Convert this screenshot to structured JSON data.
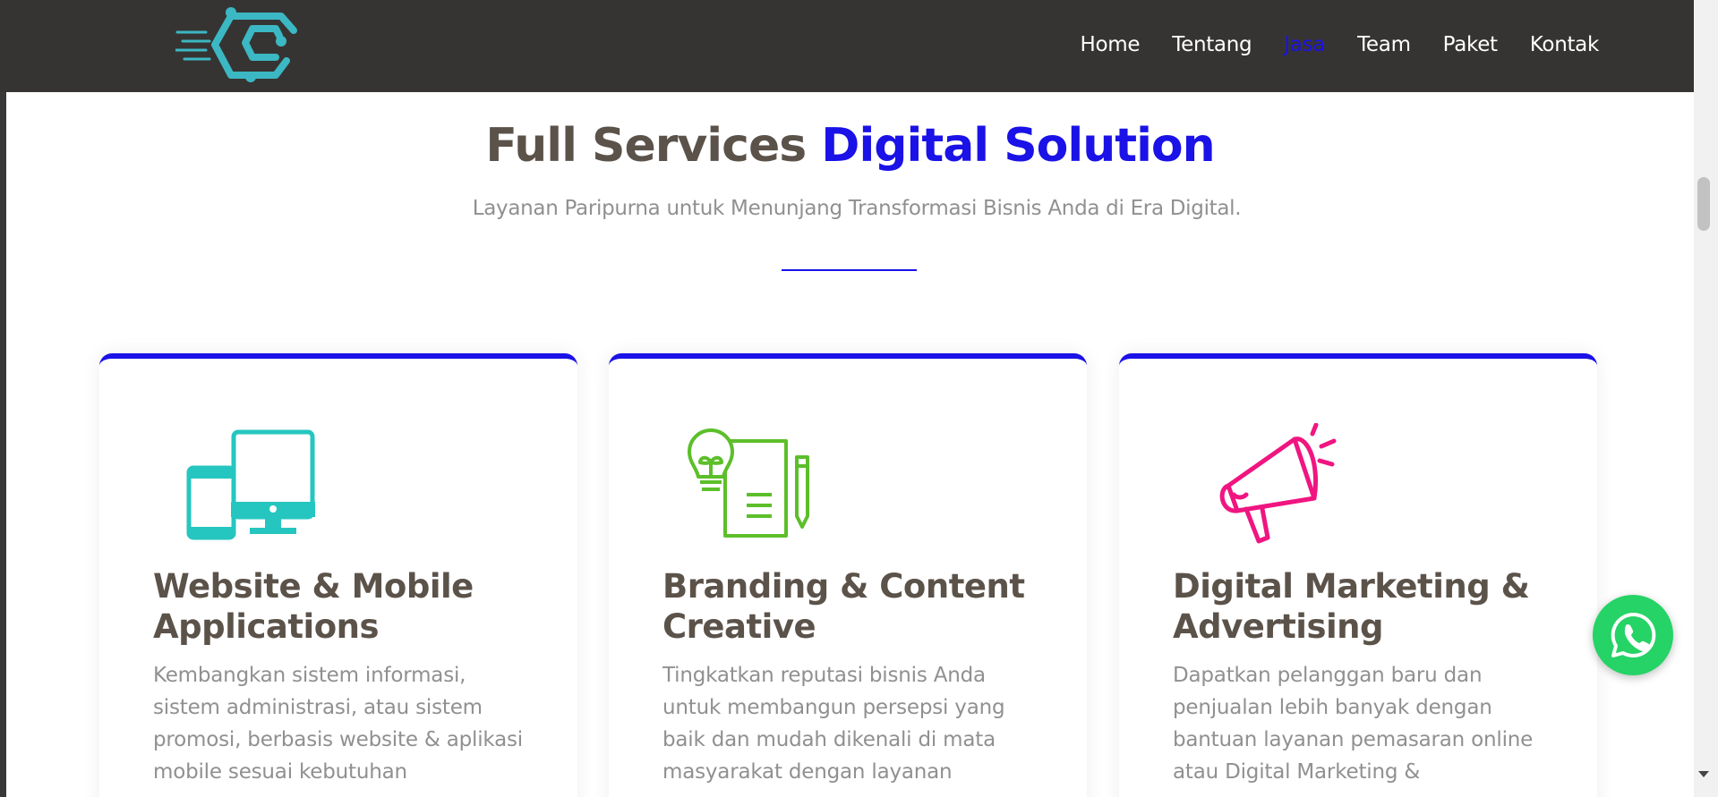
{
  "nav": {
    "items": [
      {
        "label": "Home"
      },
      {
        "label": "Tentang"
      },
      {
        "label": "Jasa",
        "active": true
      },
      {
        "label": "Team"
      },
      {
        "label": "Paket"
      },
      {
        "label": "Kontak"
      }
    ],
    "active_color": "#1a12e6"
  },
  "services": {
    "heading_main": "Full Services",
    "heading_accent": "Digital Solution",
    "subtitle": "Layanan Paripurna untuk Menunjang Transformasi Bisnis Anda di Era Digital.",
    "cards": [
      {
        "icon": "devices-icon",
        "icon_color": "#26c6c0",
        "title": "Website & Mobile Applications",
        "text": "Kembangkan sistem informasi, sistem administrasi, atau sistem promosi, berbasis website & aplikasi mobile sesuai kebutuhan"
      },
      {
        "icon": "lightbulb-document-icon",
        "icon_color": "#5cbf2a",
        "title": "Branding & Content Creative",
        "text": "Tingkatkan reputasi bisnis Anda untuk membangun persepsi yang baik dan mudah dikenali di mata masyarakat dengan layanan"
      },
      {
        "icon": "megaphone-icon",
        "icon_color": "#f01580",
        "title": "Digital Marketing & Advertising",
        "text": "Dapatkan pelanggan baru dan penjualan lebih banyak dengan bantuan layanan pemasaran online atau Digital Marketing &"
      }
    ]
  },
  "colors": {
    "accent": "#1a12e6",
    "header_bg": "#363432",
    "heading": "#5b524a",
    "whatsapp": "#25d366",
    "logo": "#3bb8c3"
  },
  "whatsapp_button": {
    "icon": "whatsapp-icon"
  }
}
